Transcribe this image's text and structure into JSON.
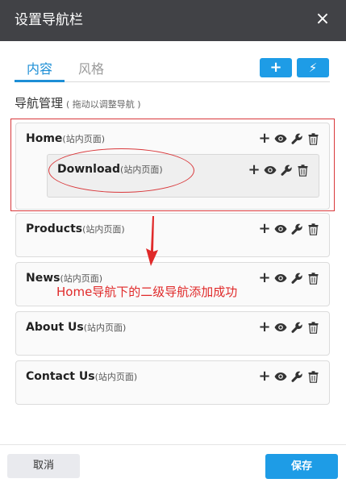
{
  "dialog": {
    "title": "设置导航栏",
    "close_symbol": "×"
  },
  "tabs": [
    {
      "label": "内容",
      "active": true
    },
    {
      "label": "风格",
      "active": false
    }
  ],
  "toolbar": {
    "add_symbol": "+",
    "bolt_symbol": "⚡"
  },
  "section": {
    "title": "导航管理",
    "hint": "( 拖动以调整导航 )"
  },
  "nav_items": [
    {
      "label": "Home",
      "type": "(站内页面)",
      "children": [
        {
          "label": "Download",
          "type": "(站内页面)"
        }
      ]
    },
    {
      "label": "Products",
      "type": "(站内页面)"
    },
    {
      "label": "News",
      "type": "(站内页面)"
    },
    {
      "label": "About Us",
      "type": "(站内页面)"
    },
    {
      "label": "Contact Us",
      "type": "(站内页面)"
    }
  ],
  "annotation": {
    "text": "Home导航下的二级导航添加成功",
    "color": "#e02a2a"
  },
  "footer": {
    "cancel_label": "取消",
    "save_label": "保存"
  },
  "colors": {
    "accent": "#1e9ce6",
    "titlebar": "#414246",
    "annotation_red": "#d9383b"
  }
}
